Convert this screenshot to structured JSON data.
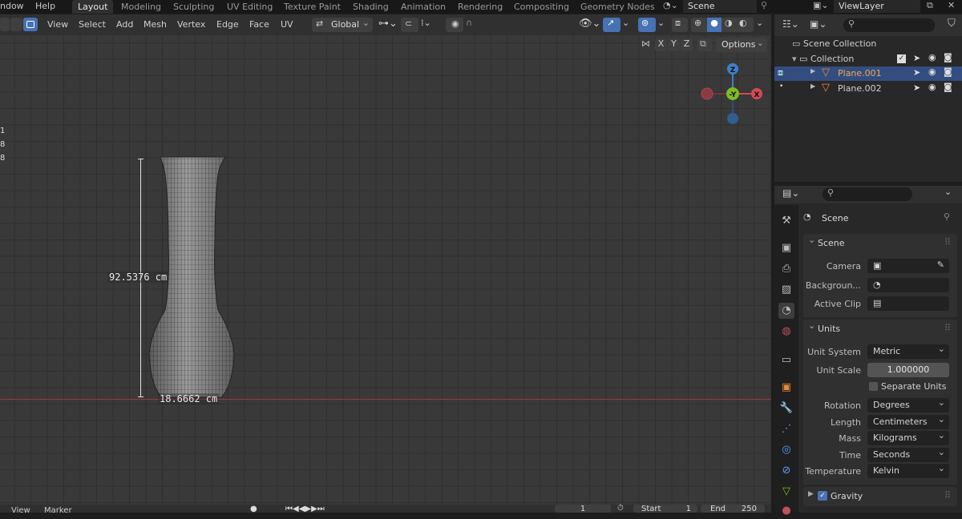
{
  "topbar": {
    "menus": [
      "ndow",
      "Help"
    ],
    "workspaces": [
      "Layout",
      "Modeling",
      "Sculpting",
      "UV Editing",
      "Texture Paint",
      "Shading",
      "Animation",
      "Rendering",
      "Compositing",
      "Geometry Nodes"
    ],
    "scene": "Scene",
    "view_layer": "ViewLayer"
  },
  "header": {
    "menus": [
      "View",
      "Select",
      "Add",
      "Mesh",
      "Vertex",
      "Edge",
      "Face",
      "UV"
    ],
    "transform": "Global",
    "options": "Options",
    "axes": [
      "X",
      "Y",
      "Z"
    ]
  },
  "viewport": {
    "left_stats": [
      "1",
      "8",
      "8"
    ],
    "height_dim": "92.5376 cm",
    "width_dim": "18.6662 cm",
    "gizmo": {
      "z": "Z",
      "y": "-Y",
      "x": "X"
    }
  },
  "timeline": {
    "items": [
      "View",
      "Marker"
    ],
    "frame": "1",
    "start_label": "Start",
    "start": "1",
    "end_label": "End",
    "end": "250"
  },
  "outliner": {
    "root": "Scene Collection",
    "collection": "Collection",
    "items": [
      "Plane.001",
      "Plane.002"
    ]
  },
  "properties": {
    "context": "Scene",
    "scene_panel": {
      "title": "Scene",
      "camera_label": "Camera",
      "background_label": "Backgroun...",
      "activeclip_label": "Active Clip"
    },
    "units_panel": {
      "title": "Units",
      "unit_system_label": "Unit System",
      "unit_system": "Metric",
      "unit_scale_label": "Unit Scale",
      "unit_scale": "1.000000",
      "separate_units": "Separate Units",
      "rotation_label": "Rotation",
      "rotation": "Degrees",
      "length_label": "Length",
      "length": "Centimeters",
      "mass_label": "Mass",
      "mass": "Kilograms",
      "time_label": "Time",
      "time": "Seconds",
      "temperature_label": "Temperature",
      "temperature": "Kelvin"
    },
    "gravity_panel": {
      "title": "Gravity"
    }
  },
  "colors": {
    "accent": "#4772b3",
    "x_axis": "#d44a54",
    "y_axis": "#7cbd21",
    "z_axis": "#3f80c9",
    "object_orange": "#e8893b"
  }
}
